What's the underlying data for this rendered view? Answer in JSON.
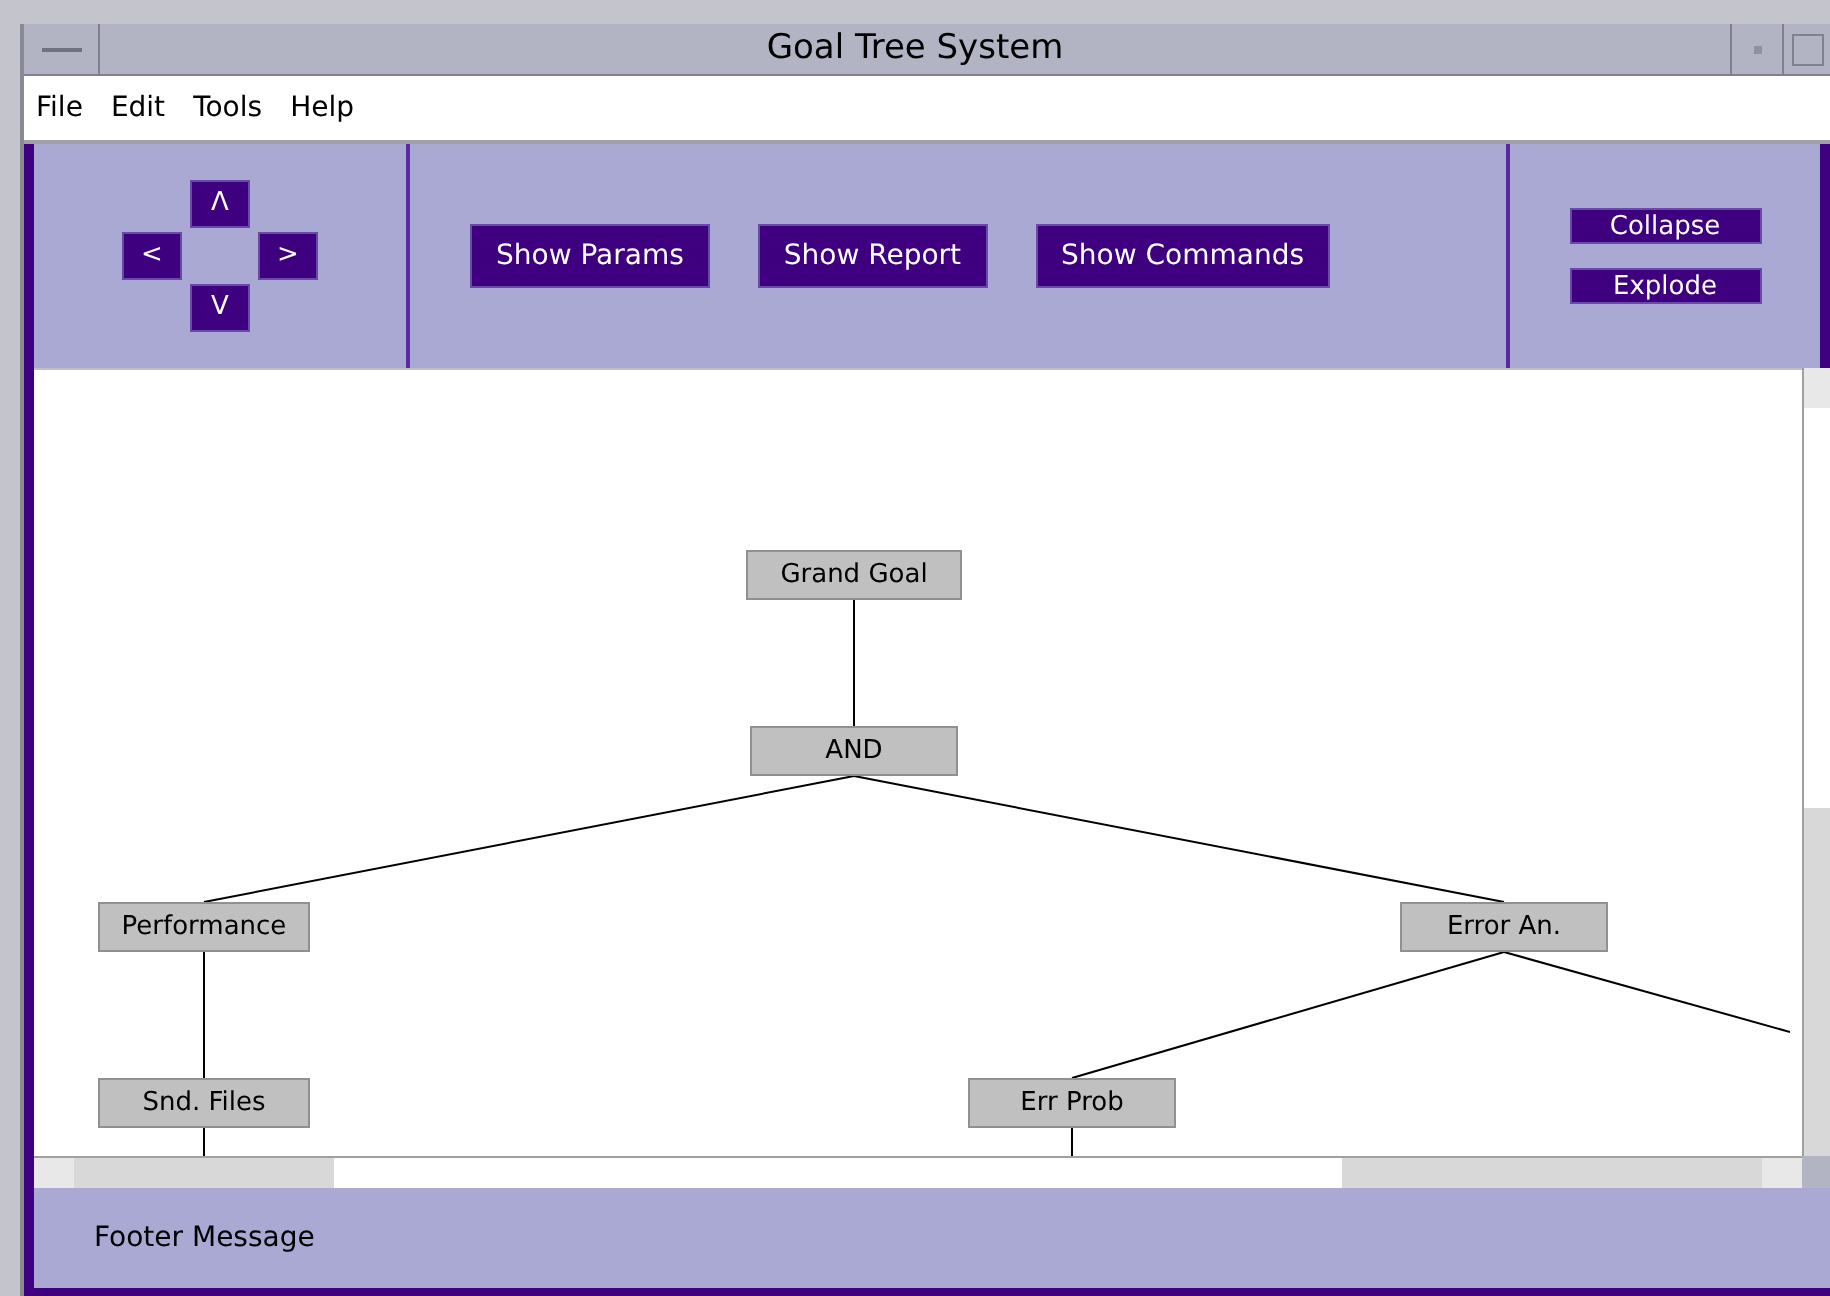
{
  "window": {
    "title": "Goal Tree System"
  },
  "menu": [
    "File",
    "Edit",
    "Tools",
    "Help"
  ],
  "nav_buttons": [
    {
      "kind": "up",
      "label": "Λ"
    },
    {
      "kind": "left",
      "label": "<"
    },
    {
      "kind": "right",
      "label": ">"
    },
    {
      "kind": "down",
      "label": "V"
    }
  ],
  "toolbar_buttons": [
    "Show Params",
    "Show Report",
    "Show Commands"
  ],
  "tree_buttons": [
    "Collapse",
    "Explode"
  ],
  "tree": {
    "label": "Grand Goal",
    "children": [
      {
        "label": "AND",
        "children": [
          {
            "label": "Performance",
            "children": [
              {
                "label": "Snd. Files"
              }
            ]
          },
          {
            "label": "Error An.",
            "children": [
              {
                "label": "Err Prob"
              }
            ]
          }
        ]
      }
    ]
  },
  "footer": "Footer Message"
}
